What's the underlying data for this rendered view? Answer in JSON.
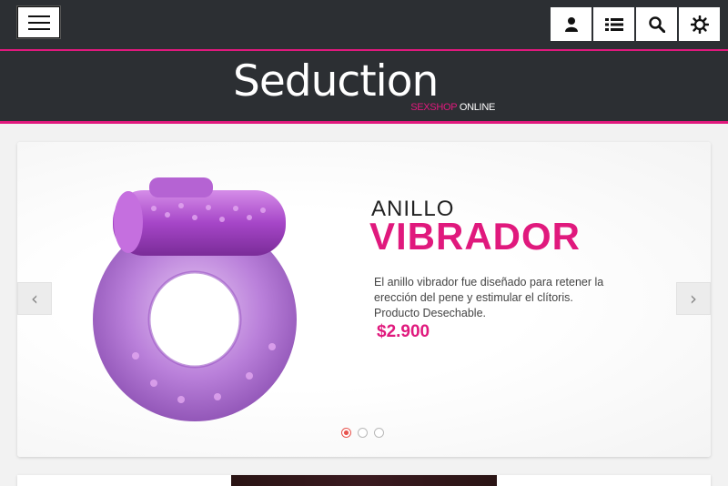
{
  "header": {
    "menu_icon": "hamburger-menu-icon",
    "tools": [
      {
        "name": "user-icon"
      },
      {
        "name": "list-icon"
      },
      {
        "name": "search-icon"
      },
      {
        "name": "settings-icon"
      }
    ],
    "logo": {
      "main": "Seduction",
      "sub_pink": "SEXSHOP",
      "sub_white": "ONLINE"
    }
  },
  "slider": {
    "title_small": "ANILLO",
    "title_big": "VIBRADOR",
    "description": "El anillo vibrador fue diseñado para retener la erección del pene y estimular el clítoris. Producto Desechable.",
    "price": "$2.900",
    "prev_label": "‹",
    "next_label": "›",
    "slide_count": 3,
    "active_slide": 1
  },
  "colors": {
    "accent": "#e0197d",
    "dark": "#2c2f33",
    "dot_active": "#e8534d"
  }
}
